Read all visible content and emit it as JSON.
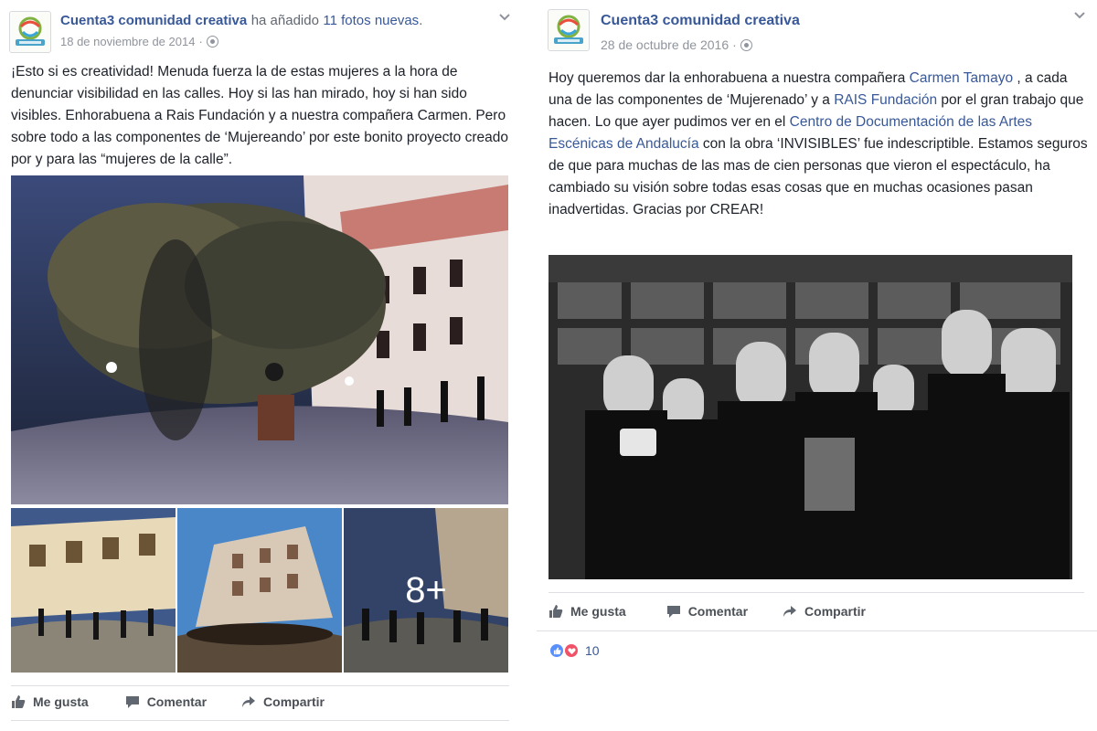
{
  "left_post": {
    "page_name": "Cuenta3 comunidad creativa",
    "action_text": "ha añadido",
    "action_link": "11 fotos nuevas",
    "action_end": ".",
    "date": "18 de noviembre de 2014",
    "meta_sep": "·",
    "text": "¡Esto si es creatividad! Menuda fuerza la de estas mujeres a la hora de denunciar visibilidad en las calles. Hoy si las han mirado, hoy si han sido visibles. Enhorabuena a Rais Fundación y a nuestra compañera Carmen. Pero sobre todo a las componentes de ‘Mujereando’ por este bonito proyecto creado por y para las “mujeres de la calle”.",
    "more_photos": "8+",
    "actions": {
      "like": "Me gusta",
      "comment": "Comentar",
      "share": "Compartir"
    }
  },
  "right_post": {
    "page_name": "Cuenta3 comunidad creativa",
    "date": "28 de octubre de 2016",
    "meta_sep": "·",
    "text_parts": {
      "p1": "Hoy queremos dar la enhorabuena a nuestra compañera ",
      "link1": "Carmen Tamayo",
      "p2": " , a cada una de las componentes de ‘Mujerenado’ y a ",
      "link2": "RAIS Fundación",
      "p3": " por el gran trabajo que hacen. Lo que ayer pudimos ver en el ",
      "link3": "Centro de Documentación de las Artes Escénicas de Andalucía",
      "p4": " con la obra ‘INVISIBLES’ fue indescriptible. Estamos seguros de que para muchas de las mas de cien personas que vieron el espectáculo, ha cambiado su visión sobre todas esas cosas que en muchas ocasiones pasan inadvertidas. Gracias por CREAR!"
    },
    "actions": {
      "like": "Me gusta",
      "comment": "Comentar",
      "share": "Compartir"
    },
    "reaction_count": "10"
  },
  "colors": {
    "link": "#385898",
    "text": "#1d2129",
    "meta": "#90949c",
    "like_blue": "#5890ff",
    "love_red": "#f25268"
  },
  "icons": [
    "globe-icon",
    "chevron-down-icon",
    "like-icon",
    "comment-icon",
    "share-icon",
    "like-reaction-icon",
    "love-reaction-icon"
  ]
}
